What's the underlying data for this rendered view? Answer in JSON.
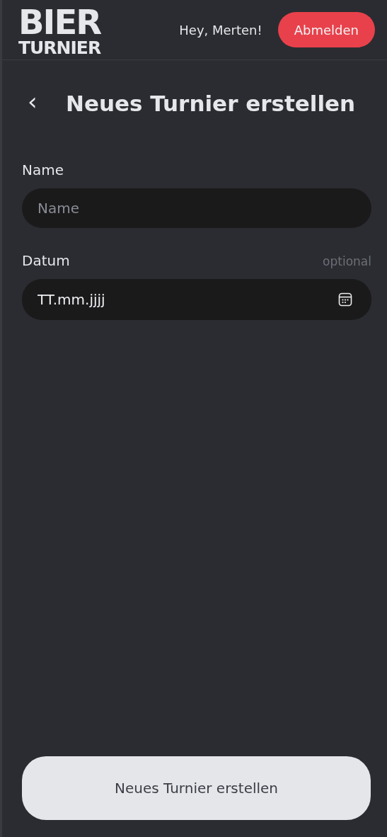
{
  "header": {
    "logo": {
      "line_1": "BIER",
      "line_2": "TURNIER"
    },
    "greeting": "Hey, Merten!",
    "logout_button": "Abmelden"
  },
  "page": {
    "back": "‹",
    "title": "Neues Turnier erstellen"
  },
  "fields": [
    {
      "kind": "text",
      "label": "Name",
      "placeholder": "Name"
    },
    {
      "kind": "date",
      "label": "Datum",
      "hint": "optional",
      "placeholder": "TT.mm.jjjj"
    }
  ],
  "submit_button": "Neues Turnier erstellen"
}
